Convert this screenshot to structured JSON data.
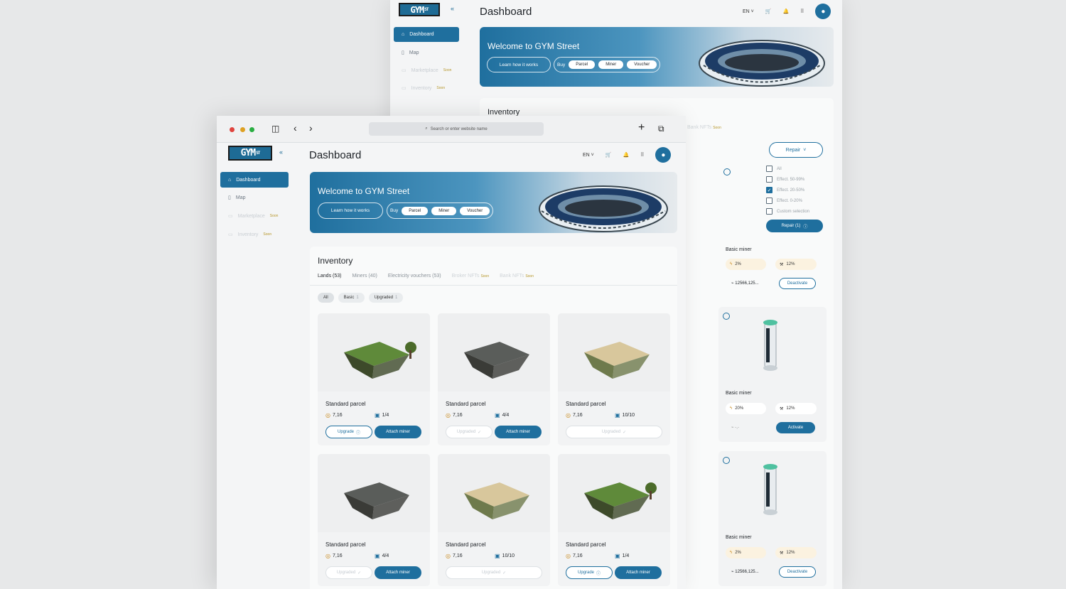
{
  "colors": {
    "accent": "#1f6f9e",
    "soon": "#b6962a",
    "background": "#e7e8e9"
  },
  "app": {
    "logo_text": "GYM",
    "logo_sup": "ST",
    "title": "Dashboard",
    "language": "EN",
    "collapse_icon": "chevrons-left-icon"
  },
  "sidebar": {
    "items": [
      {
        "label": "Dashboard",
        "icon": "home-icon",
        "active": true
      },
      {
        "label": "Map",
        "icon": "map-icon"
      },
      {
        "label": "Marketplace",
        "icon": "store-icon",
        "badge": "Soon"
      },
      {
        "label": "Inventory",
        "icon": "box-icon",
        "badge": "Soon"
      }
    ]
  },
  "browser": {
    "search_placeholder": "Search or enter website name"
  },
  "banner": {
    "title": "Welcome to GYM Street",
    "learn": "Learn how it works",
    "buy": "Buy",
    "options": [
      "Parcel",
      "Miner",
      "Voucher"
    ]
  },
  "inventory": {
    "title": "Inventory",
    "tabs": [
      {
        "label": "Lands (53)"
      },
      {
        "label": "Miners (40)"
      },
      {
        "label": "Electricity vouchers (53)"
      },
      {
        "label": "Broker NFTs",
        "badge": "Soon"
      },
      {
        "label": "Bank NFTs",
        "badge": "Soon"
      }
    ],
    "filters": [
      {
        "label": "All",
        "count": ""
      },
      {
        "label": "Basic",
        "count": "1"
      },
      {
        "label": "Upgraded",
        "count": "1"
      }
    ],
    "parcels": [
      {
        "name": "Standard parcel",
        "value": "7,16",
        "slots": "1/4",
        "left": "Upgrade",
        "right": "Attach miner",
        "terrain": "grass",
        "left_dis": false,
        "single": false
      },
      {
        "name": "Standard parcel",
        "value": "7,16",
        "slots": "4/4",
        "left": "Upgraded",
        "right": "Attach miner",
        "terrain": "stone",
        "left_dis": true,
        "single": false
      },
      {
        "name": "Standard parcel",
        "value": "7,16",
        "slots": "10/10",
        "left": "Upgraded",
        "right": "",
        "terrain": "sand",
        "left_dis": true,
        "single": true
      },
      {
        "name": "Standard parcel",
        "value": "7,16",
        "slots": "4/4",
        "left": "Upgraded",
        "right": "Attach miner",
        "terrain": "stone",
        "left_dis": true,
        "single": false
      },
      {
        "name": "Standard parcel",
        "value": "7,16",
        "slots": "10/10",
        "left": "Upgraded",
        "right": "",
        "terrain": "sand",
        "left_dis": true,
        "single": true
      },
      {
        "name": "Standard parcel",
        "value": "7,16",
        "slots": "1/4",
        "left": "Upgrade",
        "right": "Attach miner",
        "terrain": "grass",
        "left_dis": false,
        "single": false
      }
    ]
  },
  "miners_panel": {
    "repair_label": "Repair",
    "filters": [
      {
        "label": "All",
        "checked": false
      },
      {
        "label": "Effect. 50-99%",
        "checked": false
      },
      {
        "label": "Effect. 20-50%",
        "checked": true
      },
      {
        "label": "Effect. 0-20%",
        "checked": false
      },
      {
        "label": "Custom selection",
        "checked": false
      }
    ],
    "repair_count_label": "Repair (1)",
    "miners": [
      {
        "name": "Basic miner",
        "power": "2%",
        "efficiency": "12%",
        "hash": "12566,125...",
        "action": "Deactivate",
        "primary": false
      },
      {
        "name": "Basic miner",
        "power": "20%",
        "efficiency": "12%",
        "hash": "-,-",
        "action": "Activate",
        "primary": true
      },
      {
        "name": "Basic miner",
        "power": "2%",
        "efficiency": "12%",
        "hash": "12566,125...",
        "action": "Deactivate",
        "primary": false
      }
    ]
  }
}
